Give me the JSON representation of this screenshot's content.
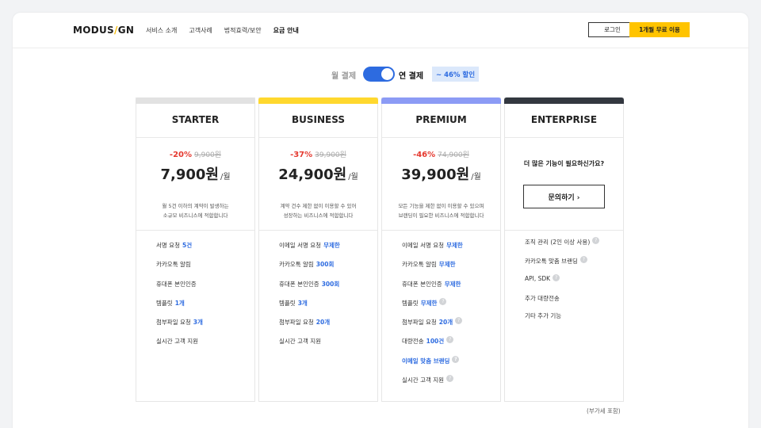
{
  "header": {
    "logo_text_1": "MODUS",
    "logo_slash": "/",
    "logo_text_2": "GN",
    "nav": [
      "서비스 소개",
      "고객사례",
      "법적효력/보안",
      "요금 안내"
    ],
    "login_label": "로그인",
    "trial_label": "1개월 무료 이용"
  },
  "billing_toggle": {
    "monthly_label": "월 결제",
    "yearly_label": "연 결제",
    "yearly_selected": true,
    "discount_badge": "~ 46% 할인"
  },
  "plans": [
    {
      "name": "STARTER",
      "color": "#e2e2e2",
      "discount_pct": "-20%",
      "original_price": "9,900원",
      "price": "7,900원",
      "unit": "/월",
      "desc_line1": "월 5건 이하의 계약이 발생하는",
      "desc_line2": "소규모 비즈니스에 적합합니다",
      "features": [
        {
          "text": "서명 요청",
          "value": "5건"
        },
        {
          "text": "카카오톡 알림",
          "value": ""
        },
        {
          "text": "휴대폰 본인인증",
          "value": ""
        },
        {
          "text": "템플릿",
          "value": "1개"
        },
        {
          "text": "첨부파일 요청",
          "value": "3개"
        },
        {
          "text": "실시간 고객 지원",
          "value": ""
        }
      ]
    },
    {
      "name": "BUSINESS",
      "color": "#ffd82e",
      "discount_pct": "-37%",
      "original_price": "39,900원",
      "price": "24,900원",
      "unit": "/월",
      "desc_line1": "계약 건수 제한 없이 이용할 수 있어",
      "desc_line2": "성장하는 비즈니스에 적합합니다",
      "features": [
        {
          "text": "이메일 서명 요청",
          "value": "무제한"
        },
        {
          "text": "카카오톡 알림",
          "value": "300회"
        },
        {
          "text": "휴대폰 본인인증",
          "value": "300회"
        },
        {
          "text": "템플릿",
          "value": "3개"
        },
        {
          "text": "첨부파일 요청",
          "value": "20개"
        },
        {
          "text": "실시간 고객 지원",
          "value": ""
        }
      ]
    },
    {
      "name": "PREMIUM",
      "color": "#8c9bf5",
      "discount_pct": "-46%",
      "original_price": "74,900원",
      "price": "39,900원",
      "unit": "/월",
      "desc_line1": "모든 기능을 제한 없이 이용할 수 있으며",
      "desc_line2": "브랜딩이 필요한 비즈니스에 적합합니다",
      "features": [
        {
          "text": "이메일 서명 요청",
          "value": "무제한",
          "help": false
        },
        {
          "text": "카카오톡 알림",
          "value": "무제한",
          "help": false
        },
        {
          "text": "휴대폰 본인인증",
          "value": "무제한",
          "help": false
        },
        {
          "text": "템플릿",
          "value": "무제한",
          "help": true
        },
        {
          "text": "첨부파일 요청",
          "value": "20개",
          "help": true
        },
        {
          "text": "대량전송",
          "value": "100건",
          "help": true
        },
        {
          "text": "이메일 맞춤 브랜딩",
          "value": "",
          "help": true,
          "blue": true
        },
        {
          "text": "실시간 고객 지원",
          "value": "",
          "help": true
        }
      ]
    },
    {
      "name": "ENTERPRISE",
      "color": "#333840",
      "question": "더 많은 기능이 필요하신가요?",
      "contact_label": "문의하기 ›",
      "features": [
        {
          "text": "조직 관리 (2인 이상 사용)",
          "help": true
        },
        {
          "text": "카카오톡 맞춤 브랜딩",
          "help": true
        },
        {
          "text": "API, SDK",
          "help": true
        },
        {
          "text": "추가 대량전송",
          "help": false
        },
        {
          "text": "기타 추가 기능",
          "help": false
        }
      ]
    }
  ],
  "vat_note": "(부가세 포함)",
  "help_glyph": "?"
}
